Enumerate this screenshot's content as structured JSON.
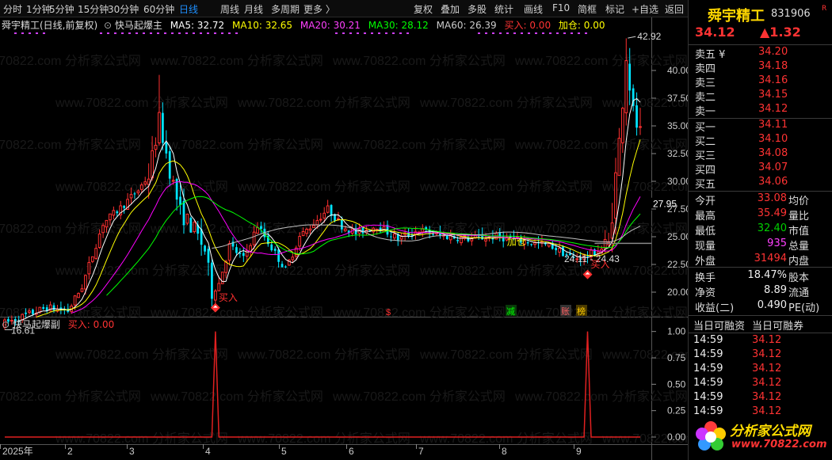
{
  "toolbar": {
    "left": [
      "分时",
      "1分钟",
      "5分钟",
      "15分钟",
      "30分钟",
      "60分钟",
      "日线",
      "周线",
      "月线",
      "多周期",
      "更多 〉"
    ],
    "active": "日线",
    "right": [
      "复权",
      "叠加",
      "多股",
      "统计",
      "画线",
      "F10",
      "简框",
      "标记",
      "+自选",
      "返回"
    ]
  },
  "main_legend": {
    "stock": "舜宇精工(日线,前复权)",
    "indicator": "快马起爆主",
    "ma5": "MA5: 32.72",
    "ma10": "MA10: 32.65",
    "ma20": "MA20: 30.21",
    "ma30": "MA30: 28.12",
    "ma60": "MA60: 26.39",
    "buy": "买入: 0.00",
    "add": "加仓: 0.00"
  },
  "sub_legend": {
    "indicator": "快马起爆副",
    "buy": "买入: 0.00"
  },
  "colors": {
    "up": "#ff3030",
    "down": "#00e5ff",
    "ma5": "#ffffff",
    "ma10": "#ffff00",
    "ma20": "#ff00ff",
    "ma30": "#00ff00",
    "ma60": "#c0c0c0",
    "accent": "#1e90ff"
  },
  "chart_data": {
    "type": "candlestick",
    "y_ticks": [
      "40.00",
      "37.50",
      "35.00",
      "32.50",
      "30.00",
      "27.50",
      "25.00",
      "22.50",
      "20.00"
    ],
    "y_range": [
      18.0,
      43.5
    ],
    "sub_ticks": [
      "1.00",
      "0.75",
      "0.50",
      "0.25",
      "0.00"
    ],
    "sub_range": [
      0,
      1.05
    ],
    "x_labels": [
      "2025年",
      "2",
      "3",
      "4",
      "5",
      "6",
      "7",
      "8",
      "9"
    ],
    "high_label": "42.92",
    "low_label": "16.61",
    "current_price_tag": "27.95",
    "range_label": "24.11 - 24.43",
    "signals": [
      "买入",
      "买入",
      "加仓"
    ],
    "markers": [
      "$",
      "减",
      "账",
      "榜"
    ],
    "buy_spikes": [
      {
        "index": 60,
        "value": 1.0
      },
      {
        "index": 166,
        "value": 1.0
      }
    ]
  },
  "side": {
    "name": "舜宇精工",
    "code": "831906",
    "flag": "R",
    "price": "34.12",
    "change": "▲1.32",
    "asks": [
      {
        "label": "卖五 ¥",
        "price": "34.20"
      },
      {
        "label": "卖四",
        "price": "34.18"
      },
      {
        "label": "卖三",
        "price": "34.16"
      },
      {
        "label": "卖二",
        "price": "34.15"
      },
      {
        "label": "卖一",
        "price": "34.12"
      }
    ],
    "bids": [
      {
        "label": "买一",
        "price": "34.11"
      },
      {
        "label": "买二",
        "price": "34.10"
      },
      {
        "label": "买三",
        "price": "34.08"
      },
      {
        "label": "买四",
        "price": "34.07"
      },
      {
        "label": "买五",
        "price": "34.06"
      }
    ],
    "stats": [
      {
        "l": "今开",
        "v": "33.08",
        "l2": "均价",
        "c": "red"
      },
      {
        "l": "最高",
        "v": "35.49",
        "l2": "量比",
        "c": "red"
      },
      {
        "l": "最低",
        "v": "32.40",
        "l2": "市值",
        "c": "grn"
      },
      {
        "l": "现量",
        "v": "935",
        "l2": "总量",
        "c": "mag"
      },
      {
        "l": "外盘",
        "v": "31494",
        "l2": "内盘",
        "c": "red"
      }
    ],
    "stats2": [
      {
        "l": "换手",
        "v": "18.47%",
        "l2": "股本"
      },
      {
        "l": "净资",
        "v": "8.89",
        "l2": "流通"
      },
      {
        "l": "收益(二)",
        "v": "0.490",
        "l2": "PE(动)"
      }
    ],
    "margin_header": [
      "当日可融资",
      "当日可融券"
    ],
    "ticks": [
      {
        "t": "14:59",
        "p": "34.12"
      },
      {
        "t": "14:59",
        "p": "34.12"
      },
      {
        "t": "14:59",
        "p": "34.12"
      },
      {
        "t": "14:59",
        "p": "34.12"
      },
      {
        "t": "14:59",
        "p": "34.12"
      },
      {
        "t": "14:59",
        "p": "34.12"
      }
    ]
  },
  "logo": {
    "text": "分析家公式网",
    "url": "www.70822.com"
  },
  "watermark": "www.70822.com 分析家公式网"
}
